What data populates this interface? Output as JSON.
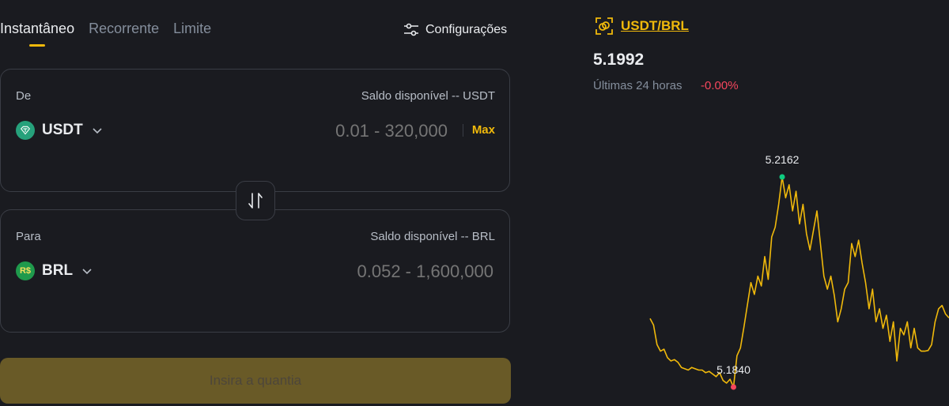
{
  "tabs": [
    {
      "label": "Instantâneo",
      "active": true
    },
    {
      "label": "Recorrente",
      "active": false
    },
    {
      "label": "Limite",
      "active": false
    }
  ],
  "settings": {
    "label": "Configurações",
    "icon": "sliders-icon"
  },
  "from": {
    "label": "De",
    "balance": "Saldo disponível -- USDT",
    "asset": "USDT",
    "asset_icon": "usdt-icon",
    "placeholder": "0.01 - 320,000",
    "max_label": "Max"
  },
  "to": {
    "label": "Para",
    "balance": "Saldo disponível -- BRL",
    "asset": "BRL",
    "asset_icon_text": "R$",
    "placeholder": "0.052 - 1,600,000"
  },
  "swap": {
    "icon": "swap-arrows-icon"
  },
  "cta": {
    "label": "Insira a quantia"
  },
  "market": {
    "pair": "USDT/BRL",
    "price": "5.1992",
    "period": "Últimas 24 horas",
    "change": "-0.00%"
  },
  "colors": {
    "accent": "#f0b90b",
    "negative": "#f6465d",
    "positive": "#0ecb81",
    "background": "#1a1b20"
  },
  "chart_data": {
    "type": "line",
    "series": [
      {
        "values": [
          5.1945,
          5.1935,
          5.1905,
          5.1895,
          5.1898,
          5.1885,
          5.188,
          5.1882,
          5.1878,
          5.187,
          5.1868,
          5.1866,
          5.187,
          5.1868,
          5.1866,
          5.1866,
          5.1862,
          5.1864,
          5.186,
          5.1856,
          5.1862,
          5.185,
          5.1846,
          5.1852,
          5.184,
          5.1888,
          5.19,
          5.1932,
          5.1966,
          5.2,
          5.1982,
          5.201,
          5.1995,
          5.204,
          5.2005,
          5.207,
          5.2085,
          5.212,
          5.2162,
          5.213,
          5.215,
          5.211,
          5.214,
          5.209,
          5.212,
          5.2075,
          5.205,
          5.208,
          5.211,
          5.206,
          5.201,
          5.199,
          5.201,
          5.198,
          5.194,
          5.196,
          5.199,
          5.2,
          5.206,
          5.204,
          5.2065,
          5.203,
          5.2,
          5.196,
          5.199,
          5.194,
          5.196,
          5.193,
          5.195,
          5.191,
          5.194,
          5.188,
          5.193,
          5.192,
          5.194,
          5.19,
          5.193,
          5.19,
          5.1895,
          5.1895,
          5.1896,
          5.1905,
          5.194,
          5.196,
          5.1965,
          5.1952,
          5.1946
        ]
      }
    ],
    "high": {
      "label": "5.2162",
      "value": 5.2162
    },
    "low": {
      "label": "5.1840",
      "value": 5.184
    },
    "grid": false,
    "line_color": "#f0b90b"
  }
}
